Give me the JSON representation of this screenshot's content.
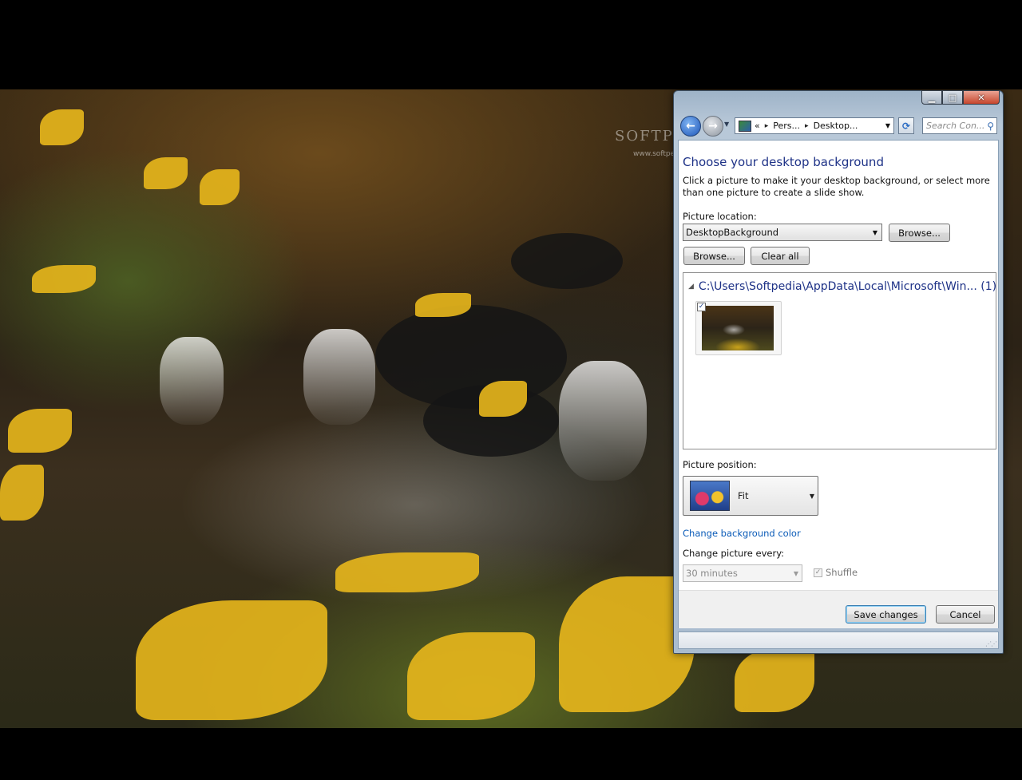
{
  "window": {
    "caption_buttons": {
      "minimize_icon": "minimize-icon",
      "maximize_icon": "maximize-icon",
      "close_icon": "close-icon"
    },
    "address": {
      "prefix": "«",
      "crumbs": [
        "Pers...",
        "Desktop..."
      ]
    },
    "search": {
      "placeholder": "Search Con..."
    }
  },
  "watermark": {
    "brand": "SOFTPEDIA",
    "url": "www.softpedia.com"
  },
  "page": {
    "title": "Choose your desktop background",
    "description": "Click a picture to make it your desktop background, or select more than one picture to create a slide show.",
    "picture_location_label": "Picture location:",
    "picture_location_value": "DesktopBackground",
    "browse_top_label": "Browse...",
    "browse_label": "Browse...",
    "clear_all_label": "Clear all",
    "group_path": "C:\\Users\\Softpedia\\AppData\\Local\\Microsoft\\Win... (1)",
    "thumbnail_checked": "✓",
    "picture_position_label": "Picture position:",
    "picture_position_value": "Fit",
    "change_color_link": "Change background color",
    "change_every_label": "Change picture every:",
    "change_every_value": "30 minutes",
    "shuffle_label": "Shuffle",
    "shuffle_checked": "✓",
    "save_label": "Save changes",
    "cancel_label": "Cancel"
  }
}
